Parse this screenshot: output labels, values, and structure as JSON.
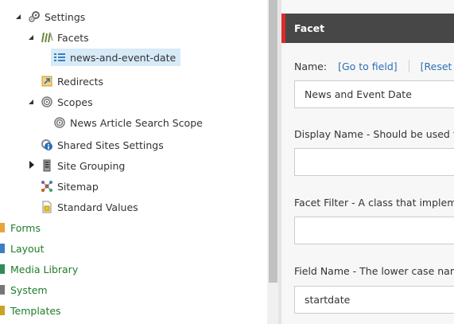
{
  "tree": {
    "items": [
      {
        "label": "Settings"
      },
      {
        "label": "Facets"
      },
      {
        "label": "news-and-event-date"
      },
      {
        "label": "Redirects"
      },
      {
        "label": "Scopes"
      },
      {
        "label": "News Article Search Scope"
      },
      {
        "label": "Shared Sites Settings"
      },
      {
        "label": "Site Grouping"
      },
      {
        "label": "Sitemap"
      },
      {
        "label": "Standard Values"
      },
      {
        "label": "Forms"
      },
      {
        "label": "Layout"
      },
      {
        "label": "Media Library"
      },
      {
        "label": "System"
      },
      {
        "label": "Templates"
      }
    ]
  },
  "content": {
    "section_title": "Facet",
    "name_label": "Name:",
    "go_to_field": "[Go to field]",
    "reset_field": "[Reset Fie",
    "name_value": "News and Event Date",
    "display_name_label": "Display Name - Should be used for a",
    "display_name_value": "",
    "facet_filter_label": "Facet Filter - A class that implements",
    "facet_filter_value": "",
    "field_name_label": "Field Name - The lower case name o",
    "field_name_value": "startdate"
  },
  "colors": {
    "accent_red": "#dc2a2a",
    "header_bg": "#474747",
    "link_blue": "#2b6fb6",
    "tree_green": "#1e7d2a",
    "selection_bg": "#d6eaf7"
  },
  "icons": {
    "settings": "gears-icon",
    "facets": "facets-icon",
    "facet_item": "list-settings-icon",
    "redirects": "redirect-icon",
    "scopes": "scope-icon",
    "scope_item": "scope-icon",
    "shared_sites": "shared-sites-icon",
    "site_grouping": "server-icon",
    "sitemap": "sitemap-icon",
    "standard_values": "standard-values-icon",
    "forms": "forms-icon",
    "layout": "layout-icon",
    "media": "media-library-icon",
    "system": "system-icon",
    "templates": "templates-icon"
  }
}
